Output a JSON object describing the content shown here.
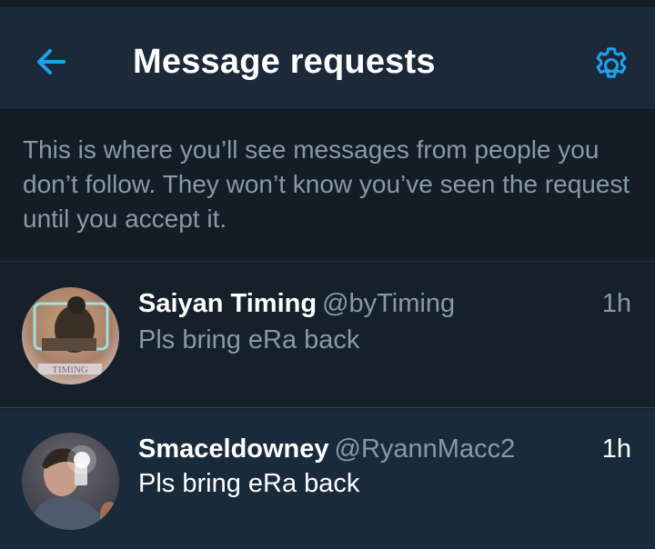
{
  "header": {
    "title": "Message requests",
    "back_icon": "arrow-left-icon",
    "settings_icon": "gear-icon",
    "accent_color": "#1da1f2"
  },
  "info": {
    "text": "This is where you’ll see messages from people you don’t follow. They won’t know you’ve seen the request until you accept it."
  },
  "requests": [
    {
      "name": "Saiyan Timing",
      "handle": "@byTiming",
      "time": "1h",
      "preview": "Pls bring eRa back",
      "avatar_text": "TIMING"
    },
    {
      "name": "Smaceldowney",
      "handle": "@RyannMacc2",
      "time": "1h",
      "preview": "Pls bring eRa back"
    }
  ]
}
